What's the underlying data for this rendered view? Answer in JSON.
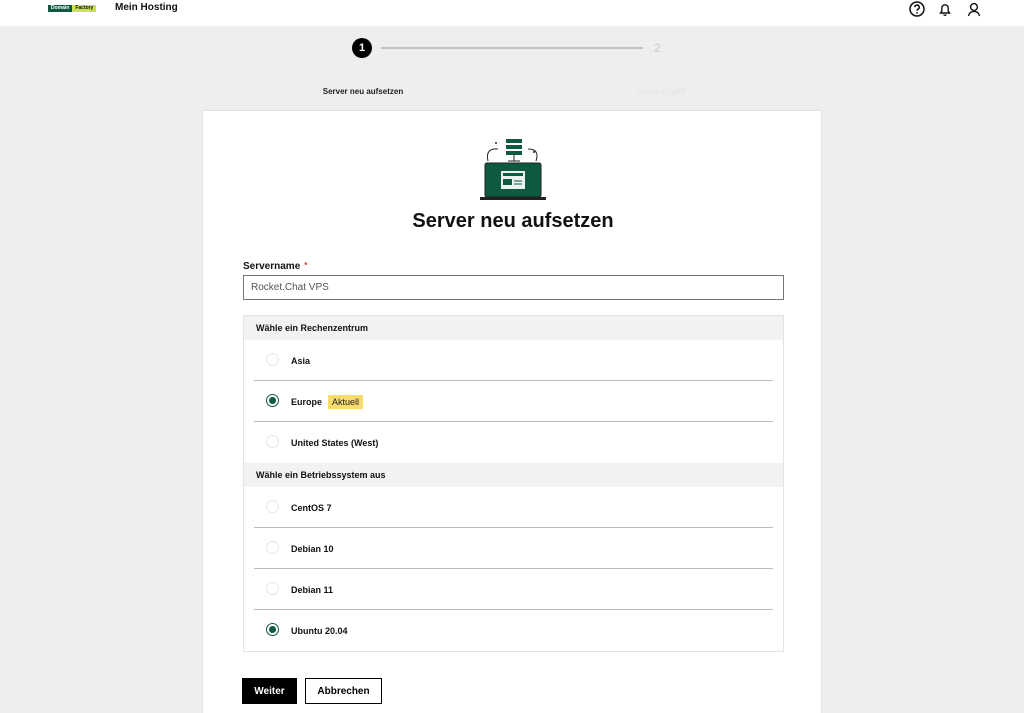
{
  "header": {
    "logo_part1": "Domain",
    "logo_part2": "Factory",
    "app_title": "Mein Hosting"
  },
  "stepper": {
    "step1_number": "1",
    "step2_number": "2",
    "step1_label": "Server neu aufsetzen",
    "step2_label": "Admin-Zugriff"
  },
  "form": {
    "title": "Server neu aufsetzen",
    "servername_label": "Servername",
    "required_mark": "*",
    "servername_value": "Rocket.Chat VPS"
  },
  "datacenter": {
    "header": "Wähle ein Rechenzentrum",
    "options": [
      {
        "label": "Asia",
        "selected": false
      },
      {
        "label": "Europe",
        "selected": true,
        "badge": "Aktuell"
      },
      {
        "label": "United States (West)",
        "selected": false
      }
    ]
  },
  "os": {
    "header": "Wähle ein Betriebssystem aus",
    "options": [
      {
        "label": "CentOS 7",
        "selected": false
      },
      {
        "label": "Debian 10",
        "selected": false
      },
      {
        "label": "Debian 11",
        "selected": false
      },
      {
        "label": "Ubuntu 20.04",
        "selected": true
      }
    ]
  },
  "buttons": {
    "next": "Weiter",
    "cancel": "Abbrechen"
  },
  "colors": {
    "brand_green": "#0d5a3f",
    "brand_lime": "#c9e34a",
    "badge_yellow": "#f7dc6c"
  }
}
